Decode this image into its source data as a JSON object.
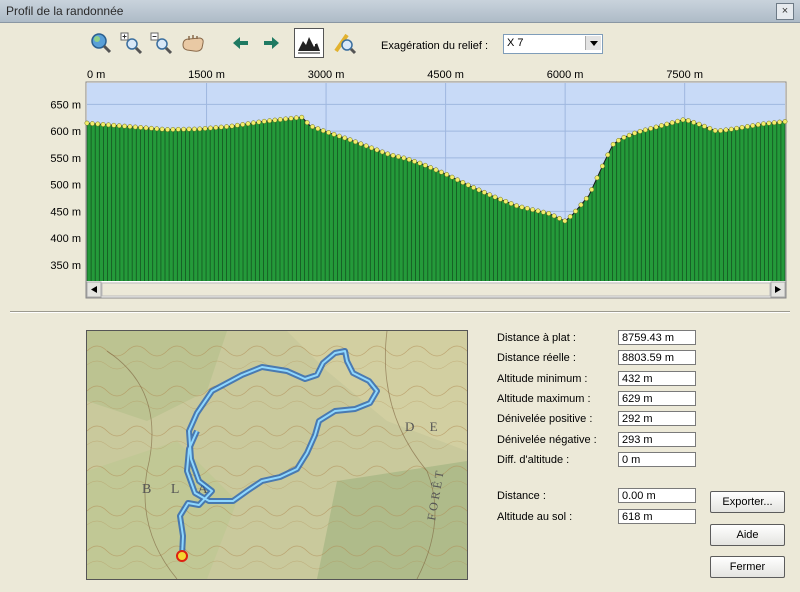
{
  "window": {
    "title": "Profil de la randonnée",
    "close_glyph": "×"
  },
  "toolbar": {
    "icons": [
      "zoom-fit-icon",
      "zoom-in-icon",
      "zoom-out-icon",
      "pan-hand-icon",
      "arrow-left-icon",
      "arrow-right-icon",
      "relief-terrain-icon",
      "measure-icon"
    ],
    "exaggeration_label": "Exagération du relief :",
    "exaggeration_value": "X 7"
  },
  "chart_data": {
    "type": "area",
    "x_ticks": [
      "0 m",
      "1500 m",
      "3000 m",
      "4500 m",
      "6000 m",
      "7500 m"
    ],
    "y_ticks": [
      "650 m",
      "600 m",
      "550 m",
      "500 m",
      "450 m",
      "400 m",
      "350 m"
    ],
    "xlim": [
      0,
      8759
    ],
    "ylim": [
      320,
      690
    ],
    "series": [
      {
        "x": [
          0,
          500,
          1000,
          1400,
          1800,
          2200,
          2500,
          2700,
          2800,
          3000,
          3300,
          3600,
          3800,
          4000,
          4200,
          4500,
          4800,
          5100,
          5400,
          5600,
          5800,
          6000,
          6100,
          6300,
          6500,
          6600,
          6700,
          6900,
          7300,
          7500,
          7700,
          7900,
          8100,
          8300,
          8500,
          8759
        ],
        "y": [
          615,
          609,
          603,
          604,
          609,
          618,
          623,
          626,
          610,
          599,
          584,
          567,
          556,
          549,
          539,
          520,
          498,
          478,
          460,
          453,
          446,
          432,
          445,
          480,
          545,
          575,
          586,
          598,
          614,
          622,
          612,
          600,
          604,
          609,
          614,
          618
        ]
      }
    ],
    "colors": {
      "fill": "#249a3a",
      "sky": "#c8daf7",
      "point": "#f2ee6c"
    }
  },
  "stats": [
    {
      "label": "Distance à plat :",
      "value": "8759.43 m"
    },
    {
      "label": "Distance réelle :",
      "value": "8803.59 m"
    },
    {
      "label": "Altitude minimum :",
      "value": "432 m"
    },
    {
      "label": "Altitude maximum :",
      "value": "629 m"
    },
    {
      "label": "Dénivelée positive :",
      "value": "292 m"
    },
    {
      "label": "Dénivelée négative :",
      "value": "293 m"
    },
    {
      "label": "Diff. d'altitude :",
      "value": "0 m"
    }
  ],
  "cursor": [
    {
      "label": "Distance :",
      "value": "0.00 m"
    },
    {
      "label": "Altitude au sol :",
      "value": "618 m"
    }
  ],
  "buttons": {
    "export": "Exporter...",
    "help": "Aide",
    "close": "Fermer"
  },
  "map": {
    "labels": [
      "B L A",
      "D E",
      "FORÊT"
    ]
  }
}
